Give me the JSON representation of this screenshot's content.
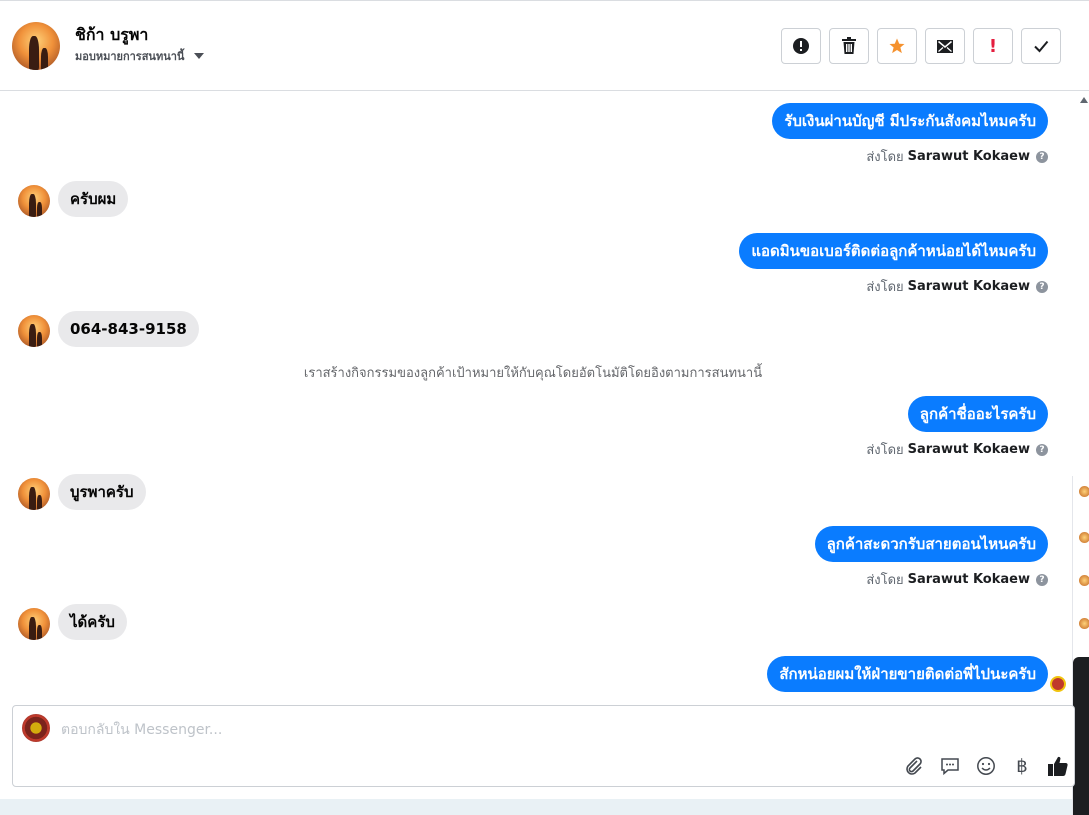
{
  "header": {
    "contact_name": "ชิก้า บรูพา",
    "assign_label": "มอบหมายการสนทนานี้",
    "tools": [
      {
        "name": "mark-spam",
        "icon": "alert-circle-icon"
      },
      {
        "name": "delete",
        "icon": "trash-icon"
      },
      {
        "name": "star",
        "icon": "star-icon"
      },
      {
        "name": "mark-unread",
        "icon": "envelope-icon"
      },
      {
        "name": "follow-up",
        "icon": "exclamation-icon",
        "glyph": "!"
      },
      {
        "name": "mark-done",
        "icon": "check-icon"
      }
    ]
  },
  "messages": {
    "m1": "รับเงินผ่านบัญชี มีประกันสังคมไหมครับ",
    "m2": "ครับผม",
    "m3": "แอดมินขอเบอร์ติดต่อลูกค้าหน่อยได้ไหมครับ",
    "m4": "064-843-9158",
    "m5": "ลูกค้าชื่ออะไรครับ",
    "m6": "บูรพาครับ",
    "m7": "ลูกค้าสะดวกรับสายตอนไหนครับ",
    "m8": "ได้ครับ",
    "m9": "สักหน่อยผมให้ฝ่ายขายติดต่อพี่ไปนะครับ"
  },
  "sent_by": {
    "prefix": "ส่งโดย",
    "agent": "Sarawut Kokaew"
  },
  "system_note": "เราสร้างกิจกรรมของลูกค้าเป้าหมายให้กับคุณโดยอัตโนมัติโดยอิงตามการสนทนานี้",
  "composer": {
    "placeholder": "ตอบกลับใน Messenger...",
    "icons": [
      "paperclip-icon",
      "saved-reply-icon",
      "emoji-icon",
      "baht-icon",
      "thumbs-up-icon"
    ],
    "baht_glyph": "฿"
  },
  "colors": {
    "outgoing_bubble": "#0a7cff",
    "incoming_bubble": "#e9e9eb",
    "star": "#f5922f",
    "follow_up": "#e41e3f"
  }
}
